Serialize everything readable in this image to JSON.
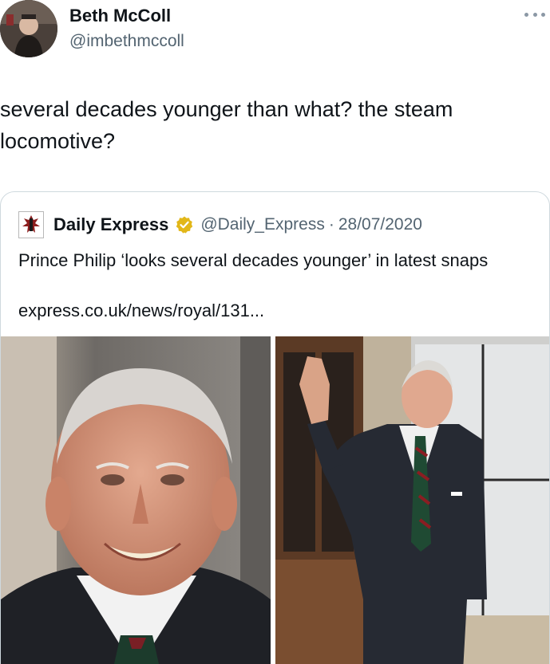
{
  "tweet": {
    "author": {
      "display_name": "Beth McColl",
      "handle": "@imbethmccoll",
      "avatar_icon": "avatar-photo"
    },
    "more_icon": "more-horizontal-icon",
    "text": "several decades younger than what? the steam locomotive?"
  },
  "quoted_tweet": {
    "logo_icon": "daily-express-crusader-logo",
    "name": "Daily Express",
    "verified_icon": "gold-verified-badge-icon",
    "verified_color": "#e2b719",
    "handle": "@Daily_Express",
    "separator": "·",
    "date": "28/07/2020",
    "headline": "Prince Philip ‘looks several decades younger’ in latest snaps",
    "link": "express.co.uk/news/royal/131...",
    "photos": [
      {
        "name": "portrait-photo",
        "description_icon": "photo-smiling-elderly-man"
      },
      {
        "name": "waving-photo",
        "description_icon": "photo-elderly-man-waving"
      }
    ]
  },
  "colors": {
    "text_primary": "#0f1419",
    "text_secondary": "#536471",
    "border": "#cfd9de"
  }
}
